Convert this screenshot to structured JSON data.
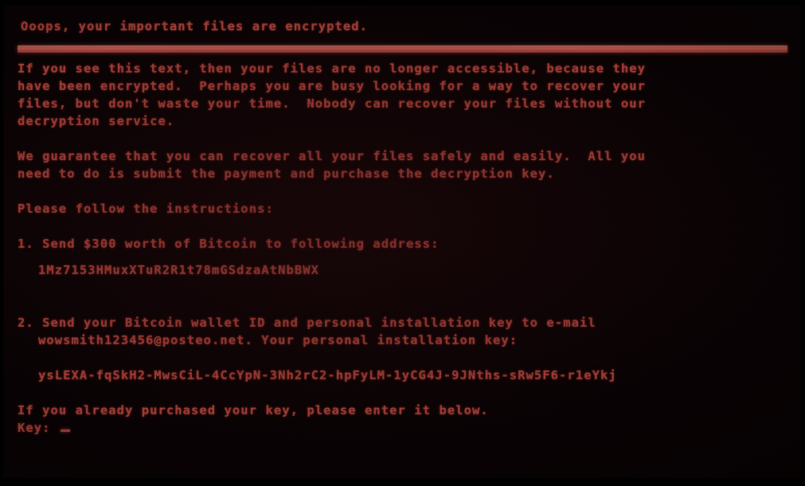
{
  "screen": {
    "title": "Ooops, your important files are encrypted.",
    "text_color": "#e8594f",
    "background_color": "#060203",
    "separator_color": "#ef6d61"
  },
  "paragraph1": [
    "If you see this text, then your files are no longer accessible, because they",
    "have been encrypted.  Perhaps you are busy looking for a way to recover your",
    "files, but don't waste your time.  Nobody can recover your files without our",
    "decryption service."
  ],
  "paragraph2": [
    "We guarantee that you can recover all your files safely and easily.  All you",
    "need to do is submit the payment and purchase the decryption key."
  ],
  "instructions_header": "Please follow the instructions:",
  "step1": {
    "text": "1. Send $300 worth of Bitcoin to following address:",
    "amount": "$300",
    "bitcoin_address": "1Mz7153HMuxXTuR2R1t78mGSdzaAtNbBWX"
  },
  "step2": {
    "line1": "2. Send your Bitcoin wallet ID and personal installation key to e-mail",
    "line2": "wowsmith123456@posteo.net. Your personal installation key:",
    "email": "wowsmith123456@posteo.net",
    "installation_key": "ysLEXA-fqSkH2-MwsCiL-4CcYpN-3Nh2rC2-hpFyLM-1yCG4J-9JNths-sRw5F6-r1eYkj"
  },
  "footer": {
    "already_purchased": "If you already purchased your key, please enter it below.",
    "key_prompt": "Key: ",
    "key_value": ""
  }
}
